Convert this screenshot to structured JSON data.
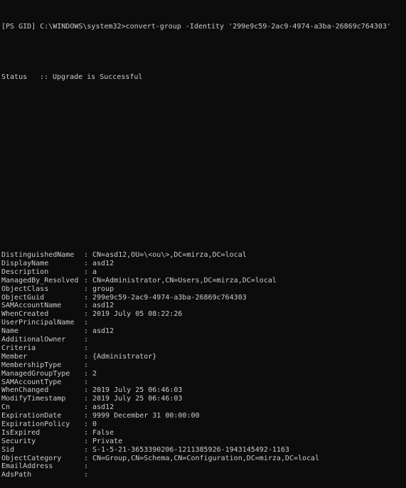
{
  "terminal": {
    "prompt": "[PS GID] C:\\WINDOWS\\system32>",
    "command": "convert-group -Identity '299e9c59-2ac9-4974-a3ba-26869c764303'",
    "status": {
      "label": "Status",
      "colon": "::",
      "value": "Upgrade is Successful"
    },
    "separator": ":",
    "properties": [
      {
        "key": "DistinguishedName",
        "value": "CN=asd12,OU=\\<ou\\>,DC=mirza,DC=local"
      },
      {
        "key": "DisplayName",
        "value": "asd12"
      },
      {
        "key": "Description",
        "value": "a"
      },
      {
        "key": "ManagedBy_Resolved",
        "value": "CN=Administrator,CN=Users,DC=mirza,DC=local"
      },
      {
        "key": "ObjectClass",
        "value": "group"
      },
      {
        "key": "ObjectGuid",
        "value": "299e9c59-2ac9-4974-a3ba-26869c764303"
      },
      {
        "key": "SAMAccountName",
        "value": "asd12"
      },
      {
        "key": "WhenCreated",
        "value": "2019 July 05 08:22:26"
      },
      {
        "key": "UserPrincipalName",
        "value": ""
      },
      {
        "key": "Name",
        "value": "asd12"
      },
      {
        "key": "AdditionalOwner",
        "value": ""
      },
      {
        "key": "Criteria",
        "value": ""
      },
      {
        "key": "Member",
        "value": "{Administrator}"
      },
      {
        "key": "MembershipType",
        "value": ""
      },
      {
        "key": "ManagedGroupType",
        "value": "2"
      },
      {
        "key": "SAMAccountType",
        "value": ""
      },
      {
        "key": "WhenChanged",
        "value": "2019 July 25 06:46:03"
      },
      {
        "key": "ModifyTimestamp",
        "value": "2019 July 25 06:46:03"
      },
      {
        "key": "Cn",
        "value": "asd12"
      },
      {
        "key": "ExpirationDate",
        "value": "9999 December 31 00:00:00"
      },
      {
        "key": "ExpirationPolicy",
        "value": "0"
      },
      {
        "key": "IsExpired",
        "value": "False"
      },
      {
        "key": "Security",
        "value": "Private"
      },
      {
        "key": "Sid",
        "value": "S-1-5-21-3653390206-1211385926-1943145492-1163"
      },
      {
        "key": "ObjectCategory",
        "value": "CN=Group,CN=Schema,CN=Configuration,DC=mirza,DC=local"
      },
      {
        "key": "EmailAddress",
        "value": ""
      },
      {
        "key": "AdsPath",
        "value": ""
      }
    ],
    "colors": {
      "background": "#0c0c0c",
      "foreground": "#cccccc"
    }
  }
}
